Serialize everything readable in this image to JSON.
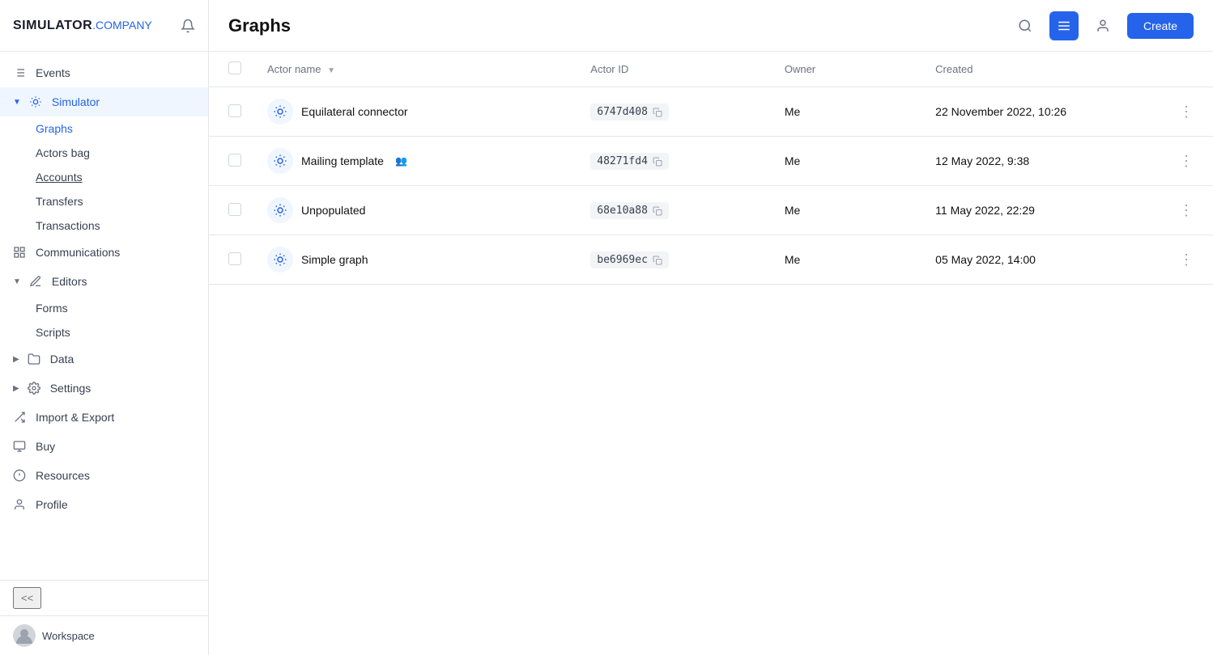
{
  "app": {
    "name_simulator": "SIMULATOR",
    "name_company": ".COMPANY"
  },
  "header": {
    "title": "Graphs",
    "create_label": "Create"
  },
  "sidebar": {
    "nav_items": [
      {
        "id": "events",
        "label": "Events",
        "icon": "list-icon",
        "expanded": false,
        "active": false
      },
      {
        "id": "simulator",
        "label": "Simulator",
        "icon": "simulator-icon",
        "expanded": true,
        "active": true
      }
    ],
    "simulator_sub": [
      {
        "id": "graphs",
        "label": "Graphs",
        "active": true
      },
      {
        "id": "actors-bag",
        "label": "Actors bag",
        "active": false
      },
      {
        "id": "accounts",
        "label": "Accounts",
        "active": false,
        "underline": true
      },
      {
        "id": "transfers",
        "label": "Transfers",
        "active": false
      },
      {
        "id": "transactions",
        "label": "Transactions",
        "active": false
      }
    ],
    "communications": {
      "id": "communications",
      "label": "Communications",
      "icon": "comm-icon"
    },
    "editors": {
      "id": "editors",
      "label": "Editors",
      "icon": "editors-icon",
      "expanded": true,
      "sub": [
        {
          "id": "forms",
          "label": "Forms"
        },
        {
          "id": "scripts",
          "label": "Scripts"
        }
      ]
    },
    "data": {
      "id": "data",
      "label": "Data",
      "icon": "data-icon"
    },
    "settings": {
      "id": "settings",
      "label": "Settings",
      "icon": "settings-icon"
    },
    "import_export": {
      "id": "import-export",
      "label": "Import & Export",
      "icon": "import-icon"
    },
    "buy": {
      "id": "buy",
      "label": "Buy",
      "icon": "buy-icon"
    },
    "resources": {
      "id": "resources",
      "label": "Resources",
      "icon": "resources-icon"
    },
    "profile": {
      "id": "profile",
      "label": "Profile",
      "icon": "profile-icon"
    },
    "collapse_label": "<<",
    "workspace_label": "Workspace"
  },
  "table": {
    "columns": {
      "actor_name": "Actor name",
      "actor_id": "Actor ID",
      "owner": "Owner",
      "created": "Created"
    },
    "rows": [
      {
        "id": 1,
        "name": "Equilateral connector",
        "actor_id": "6747d408",
        "owner": "Me",
        "created": "22 November 2022, 10:26",
        "shared": false
      },
      {
        "id": 2,
        "name": "Mailing template",
        "actor_id": "48271fd4",
        "owner": "Me",
        "created": "12 May 2022, 9:38",
        "shared": true
      },
      {
        "id": 3,
        "name": "Unpopulated",
        "actor_id": "68e10a88",
        "owner": "Me",
        "created": "11 May 2022, 22:29",
        "shared": false
      },
      {
        "id": 4,
        "name": "Simple graph",
        "actor_id": "be6969ec",
        "owner": "Me",
        "created": "05 May 2022, 14:00",
        "shared": false
      }
    ]
  }
}
